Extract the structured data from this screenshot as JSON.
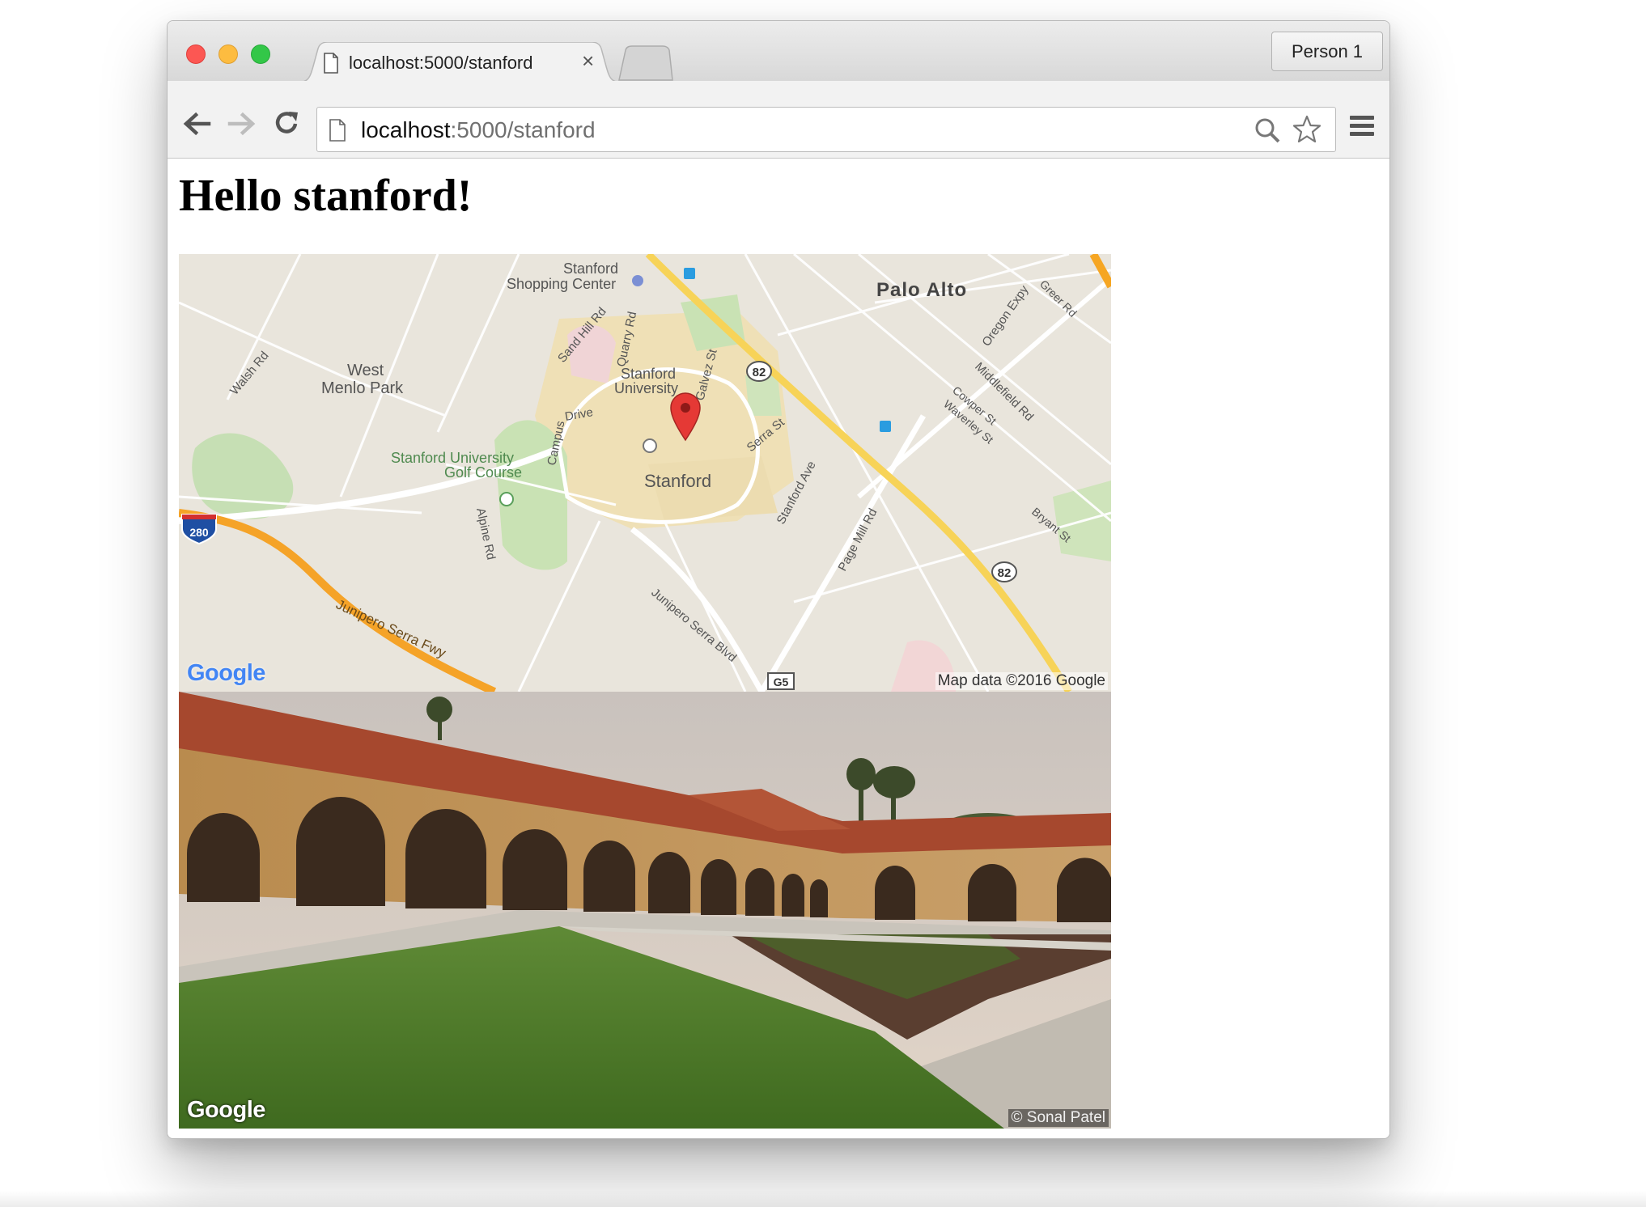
{
  "browser": {
    "tab": {
      "title": "localhost:5000/stanford",
      "close_glyph": "×"
    },
    "profile_button": "Person 1",
    "omnibox": {
      "host": "localhost",
      "rest": ":5000/stanford"
    },
    "icons": [
      "back-icon",
      "forward-icon",
      "reload-icon",
      "page-icon",
      "search-icon",
      "star-icon",
      "menu-icon"
    ],
    "traffic_lights": {
      "close": "#fc5753",
      "minimize": "#fdbc40",
      "maximize": "#33c748"
    }
  },
  "page": {
    "heading": "Hello stanford!",
    "map": {
      "labels": {
        "palo_alto": "Palo Alto",
        "stanford": "Stanford",
        "stanford_university": [
          "Stanford",
          "University"
        ],
        "shopping_center": [
          "Stanford",
          "Shopping Center"
        ],
        "west_menlo_park": [
          "West",
          "Menlo Park"
        ],
        "golf_course": [
          "Stanford University",
          "Golf Course"
        ],
        "walsh_rd": "Walsh Rd",
        "sand_hill_rd": "Sand Hill Rd",
        "quarry_rd": "Quarry Rd",
        "galvez_st": "Galvez St",
        "campus_drive": "Campus",
        "drive": "Drive",
        "serra_st": "Serra St",
        "stanford_ave": "Stanford Ave",
        "page_mill_rd": "Page Mill Rd",
        "alpine_rd": "Alpine Rd",
        "junipero_serra_fwy": "Junipero Serra Fwy",
        "junipero_serra_blvd": "Junipero Serra Blvd",
        "oregon_expy": "Oregon Expy",
        "greer_rd": "Greer Rd",
        "middlefield_rd": "Middlefield Rd",
        "cowper_st": "Cowper St",
        "waverley_st": "Waverley St",
        "bryant_st": "Bryant St",
        "shield_280": "280",
        "shield_82": "82",
        "shield_g5": "G5"
      },
      "logo": "Google",
      "copyright": "Map data ©2016 Google"
    },
    "street_view": {
      "logo": "Google",
      "copyright": "© Sonal Patel"
    }
  }
}
